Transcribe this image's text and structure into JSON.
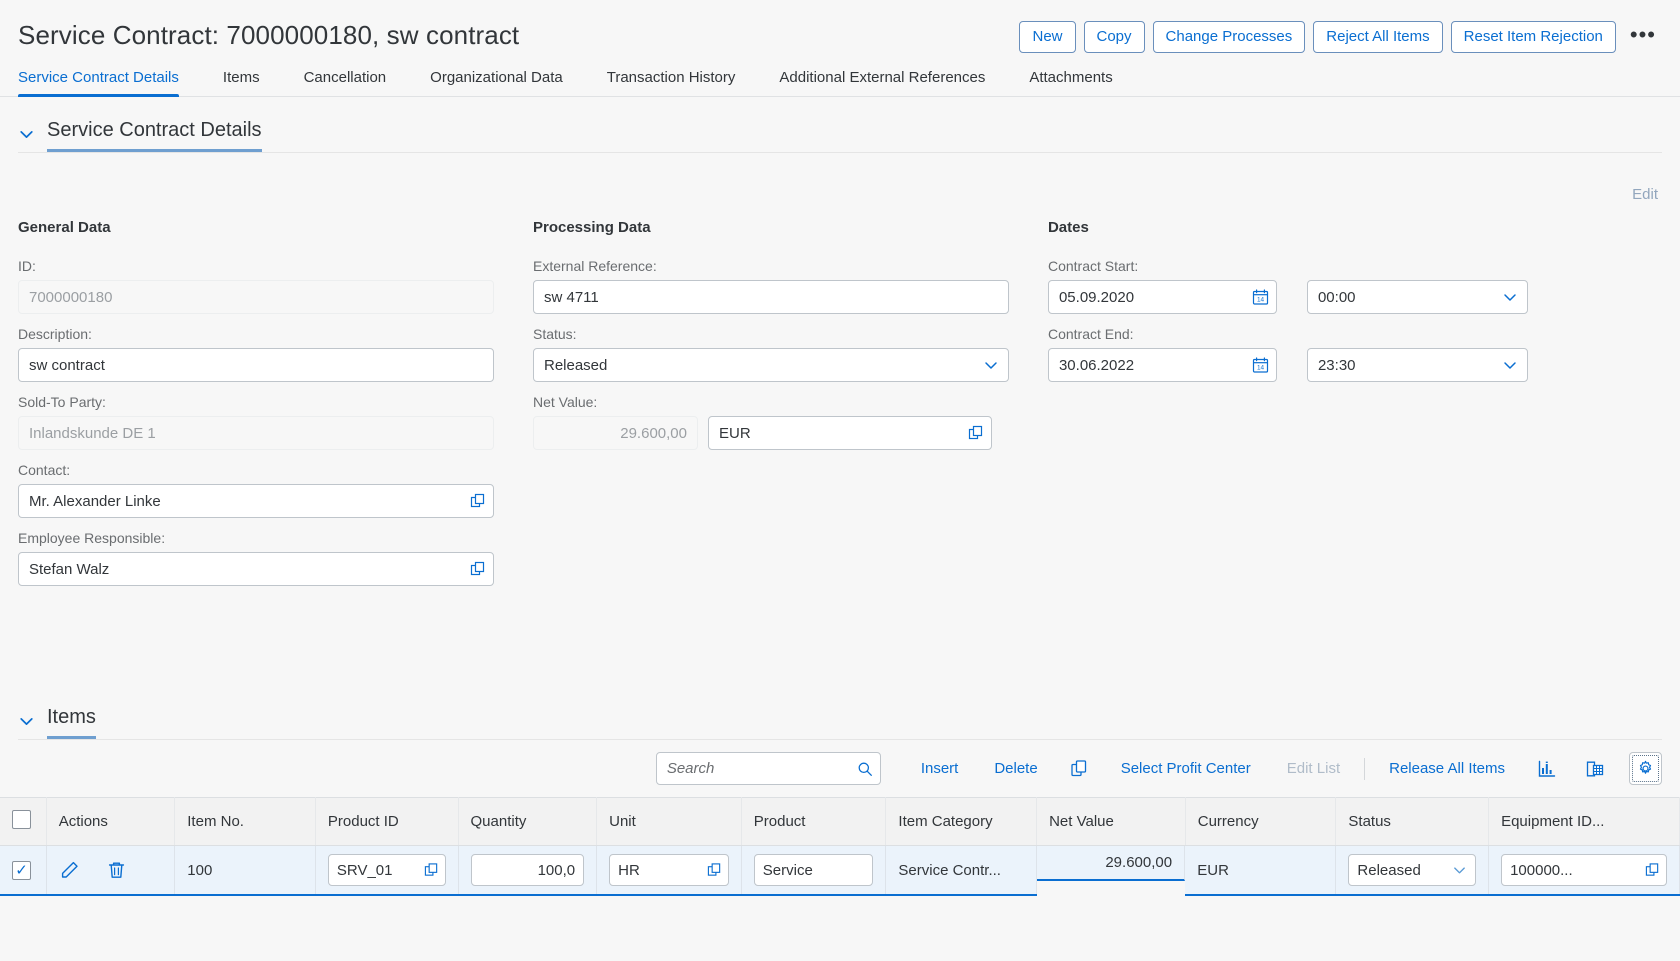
{
  "header": {
    "title": "Service Contract: 7000000180, sw contract",
    "actions": [
      {
        "label": "New",
        "name": "new-button"
      },
      {
        "label": "Copy",
        "name": "copy-button"
      },
      {
        "label": "Change Processes",
        "name": "change-processes-button"
      },
      {
        "label": "Reject All Items",
        "name": "reject-all-items-button"
      },
      {
        "label": "Reset Item Rejection",
        "name": "reset-item-rejection-button"
      }
    ],
    "overflow_label": "•••"
  },
  "tabs": [
    {
      "label": "Service Contract Details",
      "active": true
    },
    {
      "label": "Items",
      "active": false
    },
    {
      "label": "Cancellation",
      "active": false
    },
    {
      "label": "Organizational Data",
      "active": false
    },
    {
      "label": "Transaction History",
      "active": false
    },
    {
      "label": "Additional External References",
      "active": false
    },
    {
      "label": "Attachments",
      "active": false
    }
  ],
  "details_section": {
    "title": "Service Contract Details",
    "edit_label": "Edit"
  },
  "general_data": {
    "group_title": "General Data",
    "id_label": "ID:",
    "id_value": "7000000180",
    "description_label": "Description:",
    "description_value": "sw contract",
    "sold_to_label": "Sold-To Party:",
    "sold_to_value": "Inlandskunde DE 1",
    "contact_label": "Contact:",
    "contact_value": "Mr. Alexander Linke",
    "employee_label": "Employee Responsible:",
    "employee_value": "Stefan Walz"
  },
  "processing_data": {
    "group_title": "Processing Data",
    "external_reference_label": "External Reference:",
    "external_reference_value": "sw 4711",
    "status_label": "Status:",
    "status_value": "Released",
    "net_value_label": "Net Value:",
    "net_value_value": "29.600,00",
    "currency_value": "EUR"
  },
  "dates": {
    "group_title": "Dates",
    "contract_start_label": "Contract Start:",
    "contract_start_value": "05.09.2020",
    "contract_start_time": "00:00",
    "contract_end_label": "Contract End:",
    "contract_end_value": "30.06.2022",
    "contract_end_time": "23:30",
    "calendar_day": "14"
  },
  "items_section": {
    "title": "Items",
    "toolbar": {
      "search_placeholder": "Search",
      "insert_label": "Insert",
      "delete_label": "Delete",
      "copy_icon_name": "copy-icon",
      "select_profit_center_label": "Select Profit Center",
      "edit_list_label": "Edit List",
      "release_all_items_label": "Release All Items",
      "chart_icon_name": "bar-chart-icon",
      "export_icon_name": "spreadsheet-export-icon",
      "settings_icon_name": "gear-icon"
    },
    "columns": [
      "Actions",
      "Item No.",
      "Product ID",
      "Quantity",
      "Unit",
      "Product",
      "Item Category",
      "Net Value",
      "Currency",
      "Status",
      "Equipment ID..."
    ],
    "rows": [
      {
        "selected": true,
        "item_no": "100",
        "product_id": "SRV_01",
        "quantity": "100,0",
        "unit": "HR",
        "product": "Service",
        "item_category": "Service Contr...",
        "net_value": "29.600,00",
        "currency": "EUR",
        "status": "Released",
        "equipment_id": "100000..."
      }
    ]
  },
  "colors": {
    "accent": "#0a6ed1",
    "text": "#32363a",
    "label": "#6a6d70",
    "page_bg": "#f7f7f7",
    "row_selected_bg": "#ebf3fb",
    "disabled_text": "#9b9fa3"
  }
}
